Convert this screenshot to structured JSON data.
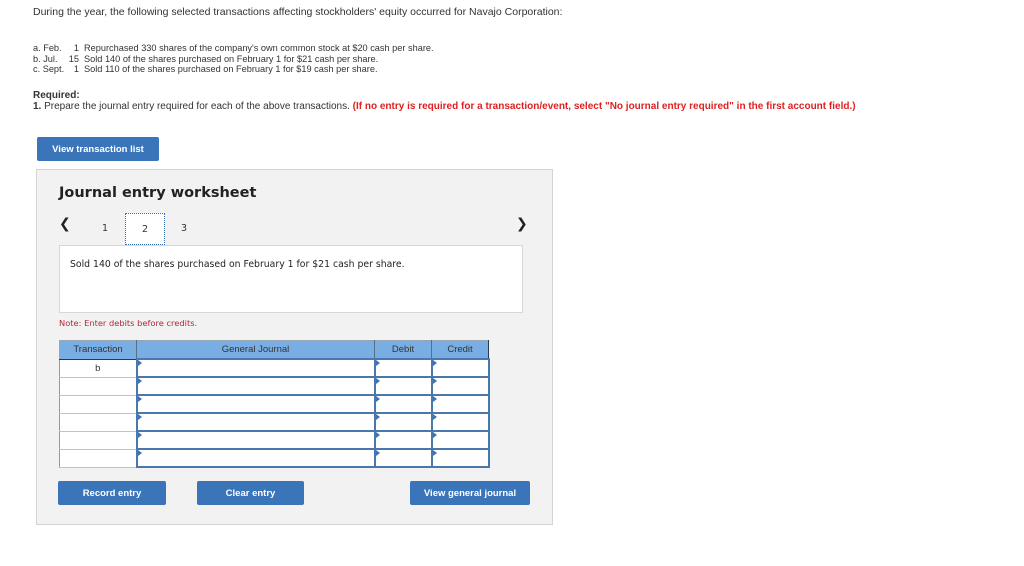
{
  "intro": "During the year, the following selected transactions affecting stockholders' equity occurred for Navajo Corporation:",
  "transactions": [
    {
      "label": "a. Feb.",
      "day": "1",
      "text": "Repurchased 330 shares of the company's own common stock at $20 cash per share."
    },
    {
      "label": "b. Jul.",
      "day": "15",
      "text": "Sold 140 of the shares purchased on February 1 for $21 cash per share."
    },
    {
      "label": "c. Sept.",
      "day": "1",
      "text": "Sold 110 of the shares purchased on February 1 for $19 cash per share."
    }
  ],
  "required": {
    "heading": "Required:",
    "number": "1.",
    "text": "Prepare the journal entry required for each of the above transactions.",
    "instruction": "(If no entry is required for a transaction/event, select \"No journal entry required\" in the first account field.)"
  },
  "view_transaction_list_label": "View transaction list",
  "worksheet": {
    "title": "Journal entry worksheet",
    "nav_prev_icon": "chevron-left",
    "nav_next_icon": "chevron-right",
    "tabs": [
      {
        "label": "1",
        "active": false
      },
      {
        "label": "2",
        "active": true
      },
      {
        "label": "3",
        "active": false
      }
    ],
    "description": "Sold 140 of the shares purchased on February 1 for $21 cash per share.",
    "note": "Note: Enter debits before credits.",
    "table": {
      "headers": {
        "transaction": "Transaction",
        "general_journal": "General Journal",
        "debit": "Debit",
        "credit": "Credit"
      },
      "rows": [
        {
          "transaction": "b",
          "account": "",
          "debit": "",
          "credit": ""
        },
        {
          "transaction": "",
          "account": "",
          "debit": "",
          "credit": ""
        },
        {
          "transaction": "",
          "account": "",
          "debit": "",
          "credit": ""
        },
        {
          "transaction": "",
          "account": "",
          "debit": "",
          "credit": ""
        },
        {
          "transaction": "",
          "account": "",
          "debit": "",
          "credit": ""
        },
        {
          "transaction": "",
          "account": "",
          "debit": "",
          "credit": ""
        }
      ]
    },
    "buttons": {
      "record": "Record entry",
      "clear": "Clear entry",
      "view_general_journal": "View general journal"
    }
  },
  "colors": {
    "button_blue": "#3a74b9",
    "header_blue": "#79aee4",
    "instruction_red": "#e02020",
    "note_red": "#b0283a"
  }
}
